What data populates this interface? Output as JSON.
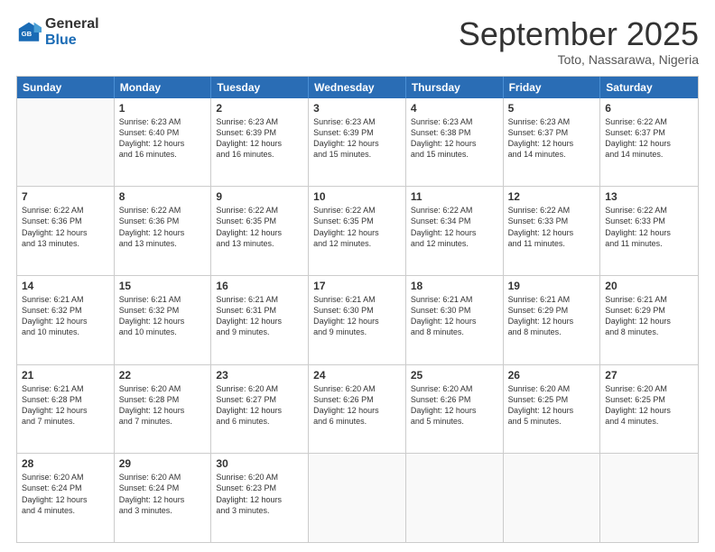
{
  "logo": {
    "general": "General",
    "blue": "Blue"
  },
  "header": {
    "month": "September 2025",
    "location": "Toto, Nassarawa, Nigeria"
  },
  "days": [
    "Sunday",
    "Monday",
    "Tuesday",
    "Wednesday",
    "Thursday",
    "Friday",
    "Saturday"
  ],
  "weeks": [
    [
      {
        "day": "",
        "info": ""
      },
      {
        "day": "1",
        "info": "Sunrise: 6:23 AM\nSunset: 6:40 PM\nDaylight: 12 hours\nand 16 minutes."
      },
      {
        "day": "2",
        "info": "Sunrise: 6:23 AM\nSunset: 6:39 PM\nDaylight: 12 hours\nand 16 minutes."
      },
      {
        "day": "3",
        "info": "Sunrise: 6:23 AM\nSunset: 6:39 PM\nDaylight: 12 hours\nand 15 minutes."
      },
      {
        "day": "4",
        "info": "Sunrise: 6:23 AM\nSunset: 6:38 PM\nDaylight: 12 hours\nand 15 minutes."
      },
      {
        "day": "5",
        "info": "Sunrise: 6:23 AM\nSunset: 6:37 PM\nDaylight: 12 hours\nand 14 minutes."
      },
      {
        "day": "6",
        "info": "Sunrise: 6:22 AM\nSunset: 6:37 PM\nDaylight: 12 hours\nand 14 minutes."
      }
    ],
    [
      {
        "day": "7",
        "info": "Sunrise: 6:22 AM\nSunset: 6:36 PM\nDaylight: 12 hours\nand 13 minutes."
      },
      {
        "day": "8",
        "info": "Sunrise: 6:22 AM\nSunset: 6:36 PM\nDaylight: 12 hours\nand 13 minutes."
      },
      {
        "day": "9",
        "info": "Sunrise: 6:22 AM\nSunset: 6:35 PM\nDaylight: 12 hours\nand 13 minutes."
      },
      {
        "day": "10",
        "info": "Sunrise: 6:22 AM\nSunset: 6:35 PM\nDaylight: 12 hours\nand 12 minutes."
      },
      {
        "day": "11",
        "info": "Sunrise: 6:22 AM\nSunset: 6:34 PM\nDaylight: 12 hours\nand 12 minutes."
      },
      {
        "day": "12",
        "info": "Sunrise: 6:22 AM\nSunset: 6:33 PM\nDaylight: 12 hours\nand 11 minutes."
      },
      {
        "day": "13",
        "info": "Sunrise: 6:22 AM\nSunset: 6:33 PM\nDaylight: 12 hours\nand 11 minutes."
      }
    ],
    [
      {
        "day": "14",
        "info": "Sunrise: 6:21 AM\nSunset: 6:32 PM\nDaylight: 12 hours\nand 10 minutes."
      },
      {
        "day": "15",
        "info": "Sunrise: 6:21 AM\nSunset: 6:32 PM\nDaylight: 12 hours\nand 10 minutes."
      },
      {
        "day": "16",
        "info": "Sunrise: 6:21 AM\nSunset: 6:31 PM\nDaylight: 12 hours\nand 9 minutes."
      },
      {
        "day": "17",
        "info": "Sunrise: 6:21 AM\nSunset: 6:30 PM\nDaylight: 12 hours\nand 9 minutes."
      },
      {
        "day": "18",
        "info": "Sunrise: 6:21 AM\nSunset: 6:30 PM\nDaylight: 12 hours\nand 8 minutes."
      },
      {
        "day": "19",
        "info": "Sunrise: 6:21 AM\nSunset: 6:29 PM\nDaylight: 12 hours\nand 8 minutes."
      },
      {
        "day": "20",
        "info": "Sunrise: 6:21 AM\nSunset: 6:29 PM\nDaylight: 12 hours\nand 8 minutes."
      }
    ],
    [
      {
        "day": "21",
        "info": "Sunrise: 6:21 AM\nSunset: 6:28 PM\nDaylight: 12 hours\nand 7 minutes."
      },
      {
        "day": "22",
        "info": "Sunrise: 6:20 AM\nSunset: 6:28 PM\nDaylight: 12 hours\nand 7 minutes."
      },
      {
        "day": "23",
        "info": "Sunrise: 6:20 AM\nSunset: 6:27 PM\nDaylight: 12 hours\nand 6 minutes."
      },
      {
        "day": "24",
        "info": "Sunrise: 6:20 AM\nSunset: 6:26 PM\nDaylight: 12 hours\nand 6 minutes."
      },
      {
        "day": "25",
        "info": "Sunrise: 6:20 AM\nSunset: 6:26 PM\nDaylight: 12 hours\nand 5 minutes."
      },
      {
        "day": "26",
        "info": "Sunrise: 6:20 AM\nSunset: 6:25 PM\nDaylight: 12 hours\nand 5 minutes."
      },
      {
        "day": "27",
        "info": "Sunrise: 6:20 AM\nSunset: 6:25 PM\nDaylight: 12 hours\nand 4 minutes."
      }
    ],
    [
      {
        "day": "28",
        "info": "Sunrise: 6:20 AM\nSunset: 6:24 PM\nDaylight: 12 hours\nand 4 minutes."
      },
      {
        "day": "29",
        "info": "Sunrise: 6:20 AM\nSunset: 6:24 PM\nDaylight: 12 hours\nand 3 minutes."
      },
      {
        "day": "30",
        "info": "Sunrise: 6:20 AM\nSunset: 6:23 PM\nDaylight: 12 hours\nand 3 minutes."
      },
      {
        "day": "",
        "info": ""
      },
      {
        "day": "",
        "info": ""
      },
      {
        "day": "",
        "info": ""
      },
      {
        "day": "",
        "info": ""
      }
    ]
  ]
}
